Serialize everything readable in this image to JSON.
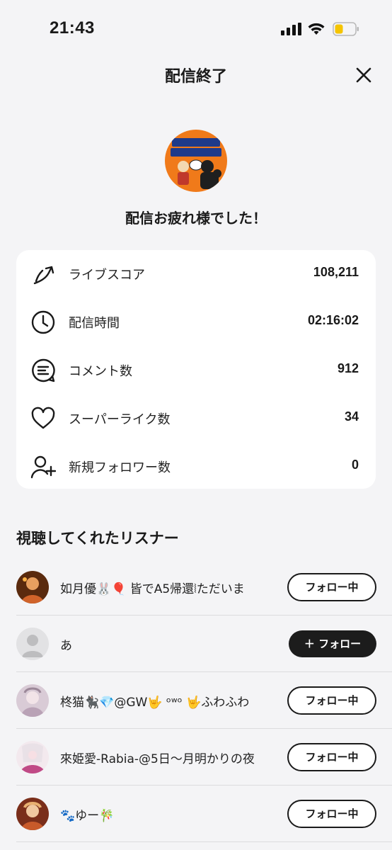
{
  "status_bar": {
    "time": "21:43"
  },
  "header": {
    "title": "配信終了"
  },
  "stream": {
    "thanks_message": "配信お疲れ様でした！"
  },
  "stats": [
    {
      "icon": "live-score-icon",
      "label": "ライブスコア",
      "value": "108,211"
    },
    {
      "icon": "clock-icon",
      "label": "配信時間",
      "value": "02:16:02"
    },
    {
      "icon": "comment-icon",
      "label": "コメント数",
      "value": "912"
    },
    {
      "icon": "heart-icon",
      "label": "スーパーライク数",
      "value": "34"
    },
    {
      "icon": "add-user-icon",
      "label": "新規フォロワー数",
      "value": "0"
    }
  ],
  "listeners_section": {
    "title": "視聴してくれたリスナー"
  },
  "listeners": [
    {
      "name": "如月優🐰🎈 皆でA5帰還⦚ただいま",
      "button": "フォロー中",
      "following": true,
      "avatar_color": "#7a3a12"
    },
    {
      "name": "あ",
      "button": "＋ フォロー",
      "following": false,
      "avatar_color": "#d8d8d8"
    },
    {
      "name": "柊猫🐈‍⬛💎@GW🤟 ᵒʷᵒ 🤟ふわふわ",
      "button": "フォロー中",
      "following": true,
      "avatar_color": "#c9b8c8"
    },
    {
      "name": "來姫愛-Rabia-@5日〜月明かりの夜",
      "button": "フォロー中",
      "following": true,
      "avatar_color": "#b04a7a"
    },
    {
      "name": "🐾ゆー🎋",
      "button": "フォロー中",
      "following": true,
      "avatar_color": "#9a4a2a"
    }
  ],
  "colors": {
    "background": "#f4f4f6",
    "card": "#ffffff",
    "button_dark": "#1c1c1c",
    "thumbnail_orange": "#f07a1a"
  }
}
